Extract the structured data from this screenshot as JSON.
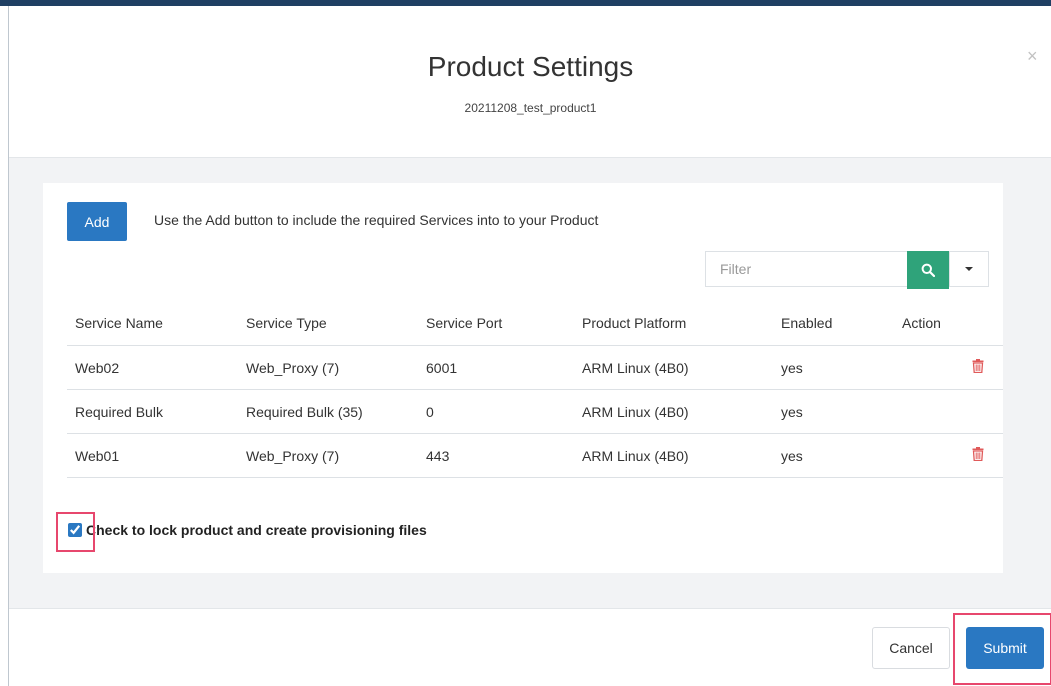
{
  "modal": {
    "title": "Product Settings",
    "subtitle": "20211208_test_product1",
    "close_glyph": "×"
  },
  "toolbar": {
    "add_label": "Add",
    "hint": "Use the Add button to include the required Services into to your Product"
  },
  "filter": {
    "placeholder": "Filter",
    "search_icon": "search-icon",
    "dropdown_icon": "caret-down-icon"
  },
  "table": {
    "headers": [
      "Service Name",
      "Service Type",
      "Service Port",
      "Product Platform",
      "Enabled",
      "Action"
    ],
    "rows": [
      {
        "name": "Web02",
        "type": "Web_Proxy (7)",
        "port": "6001",
        "platform": "ARM Linux (4B0)",
        "enabled": "yes",
        "deletable": true
      },
      {
        "name": "Required Bulk",
        "type": "Required Bulk (35)",
        "port": "0",
        "platform": "ARM Linux (4B0)",
        "enabled": "yes",
        "deletable": false
      },
      {
        "name": "Web01",
        "type": "Web_Proxy (7)",
        "port": "443",
        "platform": "ARM Linux (4B0)",
        "enabled": "yes",
        "deletable": true
      }
    ]
  },
  "lock": {
    "checked": true,
    "label": "Check to lock product and create provisioning files"
  },
  "footer": {
    "cancel_label": "Cancel",
    "submit_label": "Submit"
  },
  "colors": {
    "primary": "#2a78c2",
    "search": "#2fa37a",
    "danger": "#e05a5a",
    "highlight": "#e7476d"
  }
}
